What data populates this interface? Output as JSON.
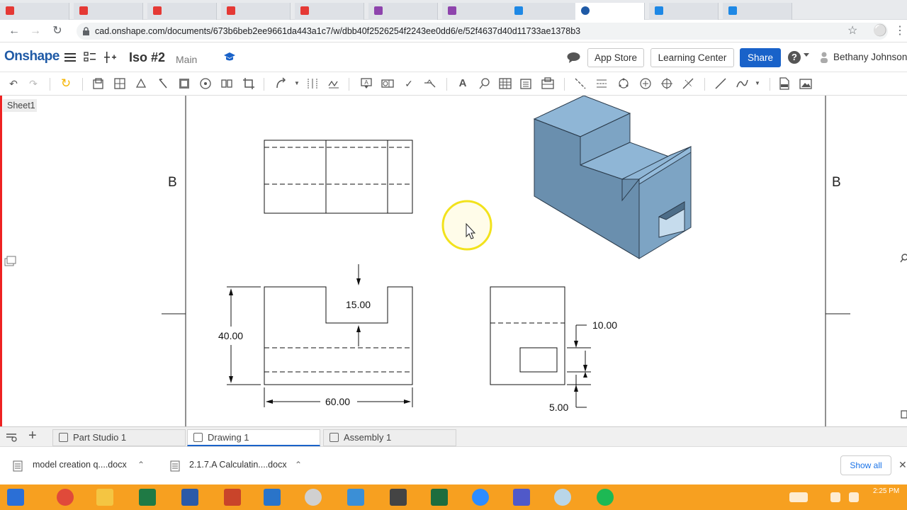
{
  "browser": {
    "url": "cad.onshape.com/documents/673b6beb2ee9661da443a1c7/w/dbb40f2526254f2243ee0dd6/e/52f4637d40d11733ae1378b3"
  },
  "header": {
    "logo": "Onshape",
    "doc_name": "Iso #2",
    "branch": "Main",
    "app_store": "App Store",
    "learning_center": "Learning Center",
    "share": "Share",
    "help": "?",
    "user": "Bethany Johnson"
  },
  "left": {
    "sheet_label": "Sheet1"
  },
  "drawing": {
    "zone_left": "B",
    "zone_right": "B",
    "dims": {
      "notch": "15.00",
      "height": "40.00",
      "width": "60.00",
      "slot_top": "10.00",
      "slot_bottom": "5.00"
    }
  },
  "bottom_tabs": {
    "part_studio": "Part Studio 1",
    "drawing": "Drawing 1",
    "assembly": "Assembly 1"
  },
  "downloads": {
    "file1": "model creation q....docx",
    "file2": "2.1.7.A Calculatin....docx",
    "show_all": "Show all"
  },
  "taskbar": {
    "time": "2:25 PM"
  },
  "colors": {
    "accent": "#1962c9",
    "part": "#7ba3c4",
    "taskbar": "#f7a020"
  }
}
